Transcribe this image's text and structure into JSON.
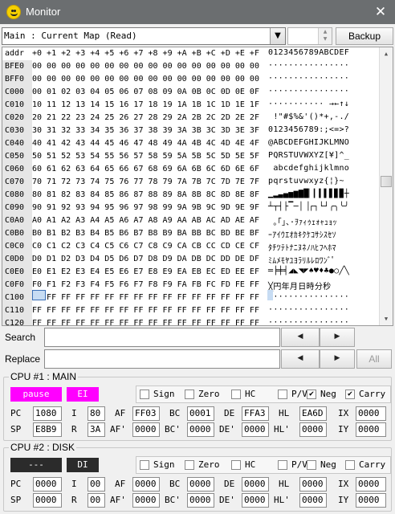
{
  "window": {
    "title": "Monitor",
    "close_icon": "close-icon",
    "app_icon": "smiley-icon"
  },
  "toolbar": {
    "map_selector": "Main : Current Map (Read)",
    "backup_label": "Backup",
    "page_value": ""
  },
  "hexview": {
    "header": {
      "addr": "addr",
      "columns": "+0 +1 +2 +3 +4 +5 +6 +7 +8 +9 +A +B +C +D +E +F",
      "ascii": "0123456789ABCDEF"
    },
    "rows": [
      {
        "addr": "BFE0",
        "hex": "00 00 00 00 00 00 00 00 00 00 00 00 00 00 00 00",
        "ascii": "················"
      },
      {
        "addr": "BFF0",
        "hex": "00 00 00 00 00 00 00 00 00 00 00 00 00 00 00 00",
        "ascii": "················"
      },
      {
        "addr": "C000",
        "hex": "00 01 02 03 04 05 06 07 08 09 0A 0B 0C 0D 0E 0F",
        "ascii": "················"
      },
      {
        "addr": "C010",
        "hex": "10 11 12 13 14 15 16 17 18 19 1A 1B 1C 1D 1E 1F",
        "ascii": "··········· →←↑↓"
      },
      {
        "addr": "C020",
        "hex": "20 21 22 23 24 25 26 27 28 29 2A 2B 2C 2D 2E 2F",
        "ascii": " !\"#$%&'()*+,-./"
      },
      {
        "addr": "C030",
        "hex": "30 31 32 33 34 35 36 37 38 39 3A 3B 3C 3D 3E 3F",
        "ascii": "0123456789:;<=>?"
      },
      {
        "addr": "C040",
        "hex": "40 41 42 43 44 45 46 47 48 49 4A 4B 4C 4D 4E 4F",
        "ascii": "@ABCDEFGHIJKLMNO"
      },
      {
        "addr": "C050",
        "hex": "50 51 52 53 54 55 56 57 58 59 5A 5B 5C 5D 5E 5F",
        "ascii": "PQRSTUVWXYZ[¥]^_"
      },
      {
        "addr": "C060",
        "hex": "60 61 62 63 64 65 66 67 68 69 6A 6B 6C 6D 6E 6F",
        "ascii": " abcdefghijklmno"
      },
      {
        "addr": "C070",
        "hex": "70 71 72 73 74 75 76 77 78 79 7A 7B 7C 7D 7E 7F",
        "ascii": "pqrstuvwxyz{¦}~ "
      },
      {
        "addr": "C080",
        "hex": "80 81 82 83 84 85 86 87 88 89 8A 8B 8C 8D 8E 8F",
        "ascii": "▁▂▃▄▅▆▇█▏▎▍▌▋▊▉┼"
      },
      {
        "addr": "C090",
        "hex": "90 91 92 93 94 95 96 97 98 99 9A 9B 9C 9D 9E 9F",
        "ascii": "┴┬┤├▔─│▕┌┐└┘╭╮╰╯"
      },
      {
        "addr": "C0A0",
        "hex": "A0 A1 A2 A3 A4 A5 A6 A7 A8 A9 AA AB AC AD AE AF",
        "ascii": " ｡｢｣､･ｦｧｨｩｪｫｬｭｮｯ"
      },
      {
        "addr": "C0B0",
        "hex": "B0 B1 B2 B3 B4 B5 B6 B7 B8 B9 BA BB BC BD BE BF",
        "ascii": "ｰｱｲｳｴｵｶｷｸｹｺｻｼｽｾｿ"
      },
      {
        "addr": "C0C0",
        "hex": "C0 C1 C2 C3 C4 C5 C6 C7 C8 C9 CA CB CC CD CE CF",
        "ascii": "ﾀﾁﾂﾃﾄﾅﾆﾇﾈﾉﾊﾋﾌﾍﾎﾏ"
      },
      {
        "addr": "C0D0",
        "hex": "D0 D1 D2 D3 D4 D5 D6 D7 D8 D9 DA DB DC DD DE DF",
        "ascii": "ﾐﾑﾒﾓﾔﾕﾖﾗﾘﾙﾚﾛﾜﾝﾞﾟ"
      },
      {
        "addr": "C0E0",
        "hex": "E0 E1 E2 E3 E4 E5 E6 E7 E8 E9 EA EB EC ED EE EF",
        "ascii": "═╞╪╡◢◣◥◤♠♥♦♣●○╱╲"
      },
      {
        "addr": "C0F0",
        "hex": "F0 F1 F2 F3 F4 F5 F6 F7 F8 F9 FA FB FC FD FE FF",
        "ascii": "╳円年月日時分秒  "
      },
      {
        "addr": "C100",
        "hex": "FF FF FF FF FF FF FF FF FF FF FF FF FF FF FF FF",
        "ascii": "················"
      },
      {
        "addr": "C110",
        "hex": "FF FF FF FF FF FF FF FF FF FF FF FF FF FF FF FF",
        "ascii": "················"
      },
      {
        "addr": "C120",
        "hex": "FF FF FF FF FF FF FF FF FF FF FF FF FF FF FF FF",
        "ascii": "················"
      }
    ],
    "selected_byte": "FF"
  },
  "search": {
    "search_label": "Search",
    "replace_label": "Replace",
    "search_value": "",
    "replace_value": "",
    "prev_icon": "triangle-left-icon",
    "next_icon": "triangle-right-icon",
    "all_label": "All"
  },
  "cpu1": {
    "title": "CPU #1 : MAIN",
    "run_label": "pause",
    "int_label": "EI",
    "accent": "#ff00ff",
    "flags": [
      {
        "label": "Sign",
        "checked": false
      },
      {
        "label": "Zero",
        "checked": false
      },
      {
        "label": "HC",
        "checked": false
      },
      {
        "label": "P/V",
        "checked": false
      },
      {
        "label": "Neg",
        "checked": true
      },
      {
        "label": "Carry",
        "checked": true
      }
    ],
    "PC": "1080",
    "SP": "E8B9",
    "I": "80",
    "R": "3A",
    "AF": "FF03",
    "AF2": "0000",
    "BC": "0001",
    "BC2": "0000",
    "DE": "FFA3",
    "DE2": "0000",
    "HL": "EA6D",
    "HL2": "0000",
    "IX": "0000",
    "IY": "0000"
  },
  "cpu2": {
    "title": "CPU #2 : DISK",
    "run_label": "---",
    "int_label": "DI",
    "accent": "#2b2b2b",
    "flags": [
      {
        "label": "Sign",
        "checked": false
      },
      {
        "label": "Zero",
        "checked": false
      },
      {
        "label": "HC",
        "checked": false
      },
      {
        "label": "P/V",
        "checked": false
      },
      {
        "label": "Neg",
        "checked": false
      },
      {
        "label": "Carry",
        "checked": false
      }
    ],
    "PC": "0000",
    "SP": "0000",
    "I": "00",
    "R": "00",
    "AF": "0000",
    "AF2": "0000",
    "BC": "0000",
    "BC2": "0000",
    "DE": "0000",
    "DE2": "0000",
    "HL": "0000",
    "HL2": "0000",
    "IX": "0000",
    "IY": "0000"
  },
  "reglabels": {
    "PC": "PC",
    "SP": "SP",
    "I": "I",
    "R": "R",
    "AF": "AF",
    "AF2": "AF'",
    "BC": "BC",
    "BC2": "BC'",
    "DE": "DE",
    "DE2": "DE'",
    "HL": "HL",
    "HL2": "HL'",
    "IX": "IX",
    "IY": "IY"
  }
}
